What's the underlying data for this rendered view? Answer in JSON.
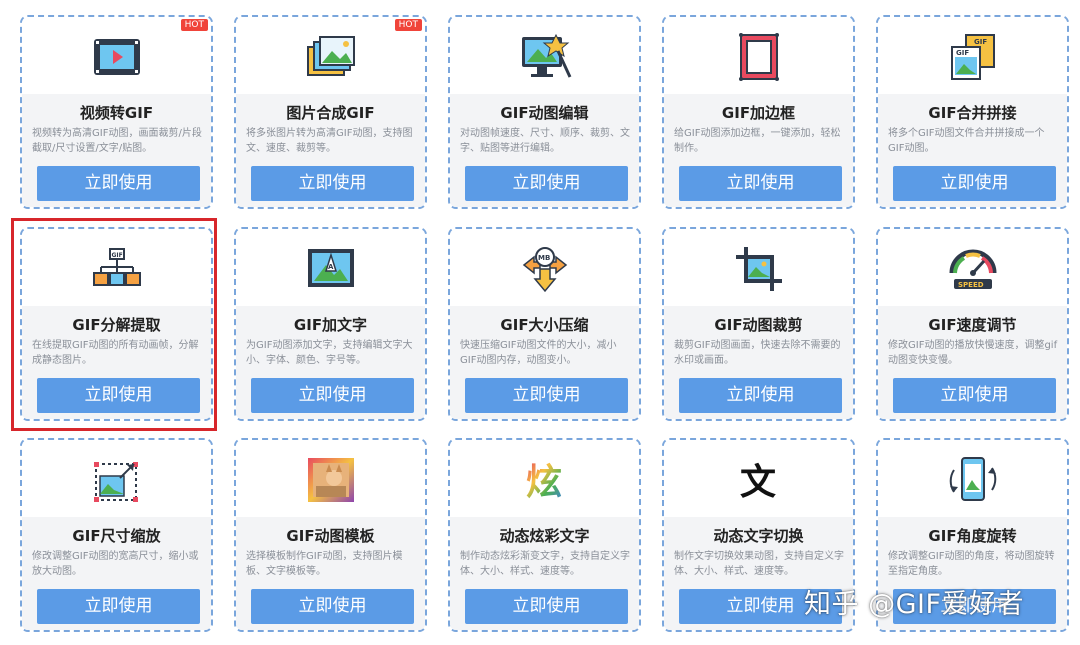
{
  "cards": [
    {
      "title": "视频转GIF",
      "desc": "视频转为高清GIF动图，画面裁剪/片段截取/尺寸设置/文字/贴图。",
      "button": "立即使用",
      "badge": "HOT",
      "icon": "video-film-icon"
    },
    {
      "title": "图片合成GIF",
      "desc": "将多张图片转为高清GIF动图，支持图文、速度、裁剪等。",
      "button": "立即使用",
      "badge": "HOT",
      "icon": "stacked-photos-icon"
    },
    {
      "title": "GIF动图编辑",
      "desc": "对动图帧速度、尺寸、顺序、裁剪、文字、贴图等进行编辑。",
      "button": "立即使用",
      "badge": "",
      "icon": "monitor-edit-icon"
    },
    {
      "title": "GIF加边框",
      "desc": "给GIF动图添加边框，一键添加，轻松制作。",
      "button": "立即使用",
      "badge": "",
      "icon": "picture-frame-icon"
    },
    {
      "title": "GIF合并拼接",
      "desc": "将多个GIF动图文件合并拼接成一个GIF动图。",
      "button": "立即使用",
      "badge": "",
      "icon": "merge-files-icon"
    },
    {
      "title": "GIF分解提取",
      "desc": "在线提取GIF动图的所有动画帧，分解成静态图片。",
      "button": "立即使用",
      "badge": "",
      "icon": "hierarchy-split-icon"
    },
    {
      "title": "GIF加文字",
      "desc": "为GIF动图添加文字，支持编辑文字大小、字体、颜色、字号等。",
      "button": "立即使用",
      "badge": "",
      "icon": "image-text-icon"
    },
    {
      "title": "GIF大小压缩",
      "desc": "快速压缩GIF动图文件的大小，减小GIF动图内存，动图变小。",
      "button": "立即使用",
      "badge": "",
      "icon": "compress-mb-icon"
    },
    {
      "title": "GIF动图裁剪",
      "desc": "裁剪GIF动图画面，快速去除不需要的水印或画面。",
      "button": "立即使用",
      "badge": "",
      "icon": "crop-icon"
    },
    {
      "title": "GIF速度调节",
      "desc": "修改GIF动图的播放快慢速度，调整gif动图变快变慢。",
      "button": "立即使用",
      "badge": "",
      "icon": "speedometer-icon"
    },
    {
      "title": "GIF尺寸缩放",
      "desc": "修改调整GIF动图的宽高尺寸，缩小或放大动图。",
      "button": "立即使用",
      "badge": "",
      "icon": "resize-image-icon"
    },
    {
      "title": "GIF动图模板",
      "desc": "选择模板制作GIF动图，支持图片模板、文字模板等。",
      "button": "立即使用",
      "badge": "",
      "icon": "template-photo-icon"
    },
    {
      "title": "动态炫彩文字",
      "desc": "制作动态炫彩渐变文字，支持自定义字体、大小、样式、速度等。",
      "button": "立即使用",
      "badge": "",
      "icon": "colorful-text-icon",
      "glyph": "炫"
    },
    {
      "title": "动态文字切换",
      "desc": "制作文字切换效果动图，支持自定义字体、大小、样式、速度等。",
      "button": "立即使用",
      "badge": "",
      "icon": "text-switch-icon",
      "glyph": "文"
    },
    {
      "title": "GIF角度旋转",
      "desc": "修改调整GIF动图的角度，将动图旋转至指定角度。",
      "button": "立即使用",
      "badge": "",
      "icon": "rotate-phone-icon"
    }
  ],
  "watermark": "知乎 @GIF爱好者",
  "speed_label": "SPEED",
  "mb_label": "MB",
  "gif_label": "GIF",
  "colors": {
    "button": "#5b9be6",
    "border": "#7aa6dc",
    "highlight": "#d7262b",
    "hot": "#f0443a"
  }
}
